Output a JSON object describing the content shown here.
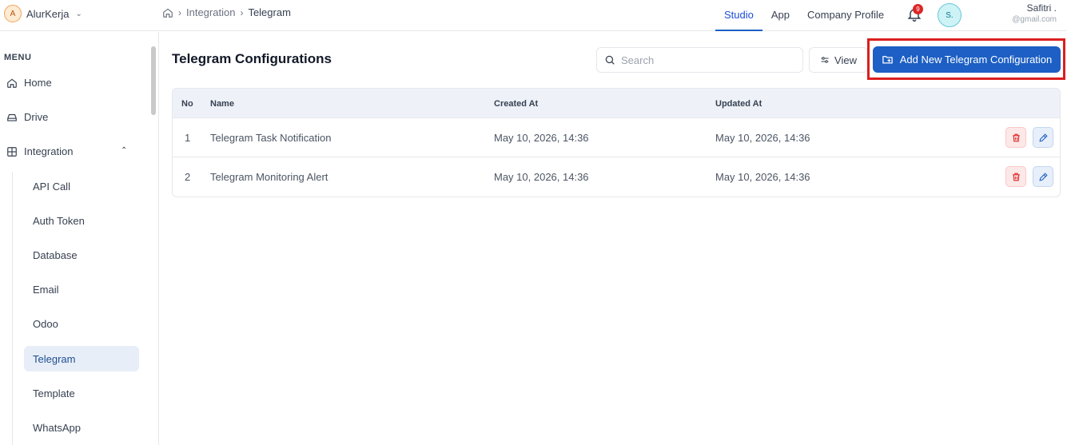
{
  "brand": {
    "initial": "A",
    "name": "AlurKerja"
  },
  "breadcrumb": {
    "items": [
      "Integration",
      "Telegram"
    ]
  },
  "topnav": {
    "tabs": [
      {
        "label": "Studio",
        "active": true
      },
      {
        "label": "App",
        "active": false
      },
      {
        "label": "Company Profile",
        "active": false
      }
    ]
  },
  "notifications": {
    "count": "9"
  },
  "user": {
    "initials": "S.",
    "name": "Safitri .",
    "email": "@gmail.com"
  },
  "sidebar": {
    "menu_label": "MENU",
    "items": [
      {
        "label": "Home",
        "icon": "home-icon"
      },
      {
        "label": "Drive",
        "icon": "drive-icon"
      },
      {
        "label": "Integration",
        "icon": "grid-icon"
      }
    ],
    "sub_items": [
      "API Call",
      "Auth Token",
      "Database",
      "Email",
      "Odoo",
      "Telegram",
      "Template",
      "WhatsApp"
    ],
    "active_sub": "Telegram"
  },
  "main": {
    "title": "Telegram Configurations",
    "search_placeholder": "Search",
    "view_label": "View",
    "add_label": "Add New Telegram Configuration"
  },
  "table": {
    "headers": [
      "No",
      "Name",
      "Created At",
      "Updated At"
    ],
    "rows": [
      {
        "no": "1",
        "name": "Telegram Task Notification",
        "created": "May 10, 2026, 14:36",
        "updated": "May 10, 2026, 14:36"
      },
      {
        "no": "2",
        "name": "Telegram Monitoring Alert",
        "created": "May 10, 2026, 14:36",
        "updated": "May 10, 2026, 14:36"
      }
    ]
  },
  "colors": {
    "primary": "#1d5fc4",
    "highlight": "#dc1e1e",
    "danger": "#dc2626"
  }
}
